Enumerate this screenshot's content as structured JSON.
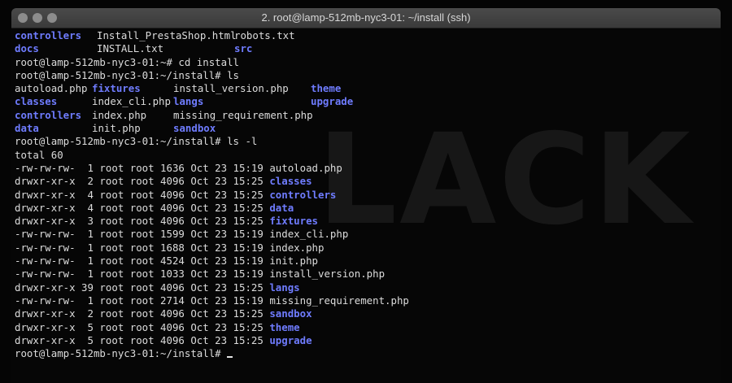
{
  "window": {
    "title": "2. root@lamp-512mb-nyc3-01: ~/install (ssh)",
    "watermark": "LACK"
  },
  "lines": [
    {
      "cells": [
        {
          "text": "controllers",
          "kind": "dir"
        },
        {
          "text": "Install_PrestaShop.html",
          "kind": "file"
        },
        {
          "text": "robots.txt",
          "kind": "file"
        }
      ]
    },
    {
      "cells": [
        {
          "text": "docs",
          "kind": "dir"
        },
        {
          "text": "INSTALL.txt",
          "kind": "file"
        },
        {
          "text": "src",
          "kind": "dir"
        }
      ]
    },
    {
      "text": "root@lamp-512mb-nyc3-01:~# cd install"
    },
    {
      "text": "root@lamp-512mb-nyc3-01:~/install# ls"
    },
    {
      "cells": [
        {
          "text": "autoload.php",
          "kind": "file"
        },
        {
          "text": "fixtures",
          "kind": "dir"
        },
        {
          "text": "install_version.php",
          "kind": "file"
        },
        {
          "text": "theme",
          "kind": "dir"
        }
      ]
    },
    {
      "cells": [
        {
          "text": "classes",
          "kind": "dir"
        },
        {
          "text": "index_cli.php",
          "kind": "file"
        },
        {
          "text": "langs",
          "kind": "dir"
        },
        {
          "text": "upgrade",
          "kind": "dir"
        }
      ]
    },
    {
      "cells": [
        {
          "text": "controllers",
          "kind": "dir"
        },
        {
          "text": "index.php",
          "kind": "file"
        },
        {
          "text": "missing_requirement.php",
          "kind": "file"
        }
      ]
    },
    {
      "cells": [
        {
          "text": "data",
          "kind": "dir"
        },
        {
          "text": "init.php",
          "kind": "file"
        },
        {
          "text": "sandbox",
          "kind": "dir"
        }
      ]
    },
    {
      "text": "root@lamp-512mb-nyc3-01:~/install# ls -l"
    },
    {
      "text": "total 60"
    },
    {
      "prefix": "-rw-rw-rw-  1 root root 1636 Oct 23 15:19 ",
      "name": "autoload.php",
      "kind": "file"
    },
    {
      "prefix": "drwxr-xr-x  2 root root 4096 Oct 23 15:25 ",
      "name": "classes",
      "kind": "dir"
    },
    {
      "prefix": "drwxr-xr-x  4 root root 4096 Oct 23 15:25 ",
      "name": "controllers",
      "kind": "dir"
    },
    {
      "prefix": "drwxr-xr-x  4 root root 4096 Oct 23 15:25 ",
      "name": "data",
      "kind": "dir"
    },
    {
      "prefix": "drwxr-xr-x  3 root root 4096 Oct 23 15:25 ",
      "name": "fixtures",
      "kind": "dir"
    },
    {
      "prefix": "-rw-rw-rw-  1 root root 1599 Oct 23 15:19 ",
      "name": "index_cli.php",
      "kind": "file"
    },
    {
      "prefix": "-rw-rw-rw-  1 root root 1688 Oct 23 15:19 ",
      "name": "index.php",
      "kind": "file"
    },
    {
      "prefix": "-rw-rw-rw-  1 root root 4524 Oct 23 15:19 ",
      "name": "init.php",
      "kind": "file"
    },
    {
      "prefix": "-rw-rw-rw-  1 root root 1033 Oct 23 15:19 ",
      "name": "install_version.php",
      "kind": "file"
    },
    {
      "prefix": "drwxr-xr-x 39 root root 4096 Oct 23 15:25 ",
      "name": "langs",
      "kind": "dir"
    },
    {
      "prefix": "-rw-rw-rw-  1 root root 2714 Oct 23 15:19 ",
      "name": "missing_requirement.php",
      "kind": "file"
    },
    {
      "prefix": "drwxr-xr-x  2 root root 4096 Oct 23 15:25 ",
      "name": "sandbox",
      "kind": "dir"
    },
    {
      "prefix": "drwxr-xr-x  5 root root 4096 Oct 23 15:25 ",
      "name": "theme",
      "kind": "dir"
    },
    {
      "prefix": "drwxr-xr-x  5 root root 4096 Oct 23 15:25 ",
      "name": "upgrade",
      "kind": "dir"
    },
    {
      "prompt": "root@lamp-512mb-nyc3-01:~/install# ",
      "cursor": true
    }
  ],
  "colors": {
    "directory": "#6f7cff",
    "file": "#dcdcdc",
    "background": "#060606"
  }
}
